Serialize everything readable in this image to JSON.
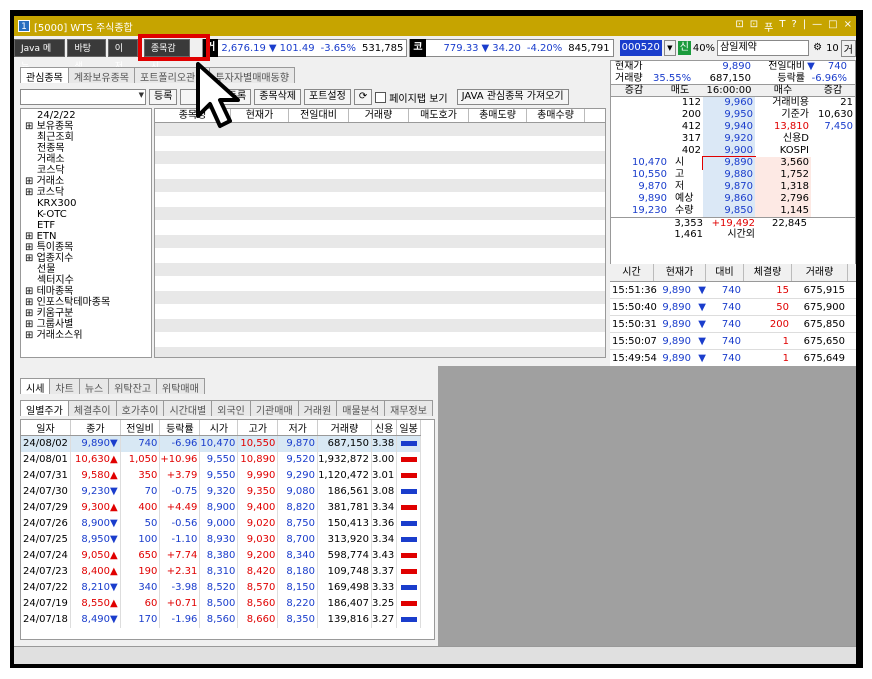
{
  "window": {
    "icon": "1",
    "title": "[5000] WTS 주식종합",
    "controls": [
      "⊡",
      "⊡",
      "푸",
      "T",
      "?",
      "|",
      "—",
      "□",
      "×"
    ]
  },
  "toolbar": {
    "java_menu": "Java 메뉴",
    "bg_color": "바탕색",
    "partial": "이저",
    "watch": "종목감시",
    "k_label": "거",
    "kospi": "2,676.19",
    "kospi_arrow": "▼",
    "kospi_change": "101.49",
    "kospi_pct": "-3.65%",
    "kospi_vol": "531,785",
    "q_label": "코",
    "kosdaq": "779.33",
    "kosdaq_arrow": "▼",
    "kosdaq_change": "34.20",
    "kosdaq_pct": "-4.20%",
    "kosdaq_vol": "845,791"
  },
  "stock_header": {
    "code": "000520",
    "badge": "신",
    "margin": "40%",
    "name": "삼일제약",
    "qty": "10",
    "geo": "거"
  },
  "tabs_top": [
    "관심종목",
    "계좌보유종목",
    "포트폴리오관리",
    "투자자별매매동향"
  ],
  "toolbar2": {
    "reg": "등록",
    "partial_reg": "종목등록",
    "del": "종목삭제",
    "pf_set": "포트설정",
    "page_view": "페이지탭 보기",
    "java_import": "JAVA 관심종목 가져오기"
  },
  "tree": [
    "24/2/22",
    "보유종목",
    "최근조회",
    "전종목",
    "거래소",
    "코스닥",
    "거래소",
    "코스닥",
    "KRX300",
    "K-OTC",
    "ETF",
    "ETN",
    "특이종목",
    "업종지수",
    "선물",
    "섹터지수",
    "테마종목",
    "인포스탁테마종목",
    "키움구분",
    "그룹사별",
    "거래소스위"
  ],
  "grid1_headers": [
    "종목명",
    "현재가",
    "전일대비",
    "거래량",
    "매도호가",
    "총매도량",
    "총매수량"
  ],
  "quote": {
    "cur_label": "현재가",
    "cur": "9,890",
    "prev_label": "전일대비",
    "prev_arrow": "▼",
    "prev": "740",
    "vol_label": "거래량",
    "vol_pct": "35.55%",
    "vol": "687,150",
    "rate_label": "등락률",
    "rate": "-6.96%",
    "h_change": "증감",
    "h_sell": "매도",
    "h_time": "16:00:00",
    "h_buy": "매수",
    "h_change2": "증감",
    "asks": [
      {
        "qty": "112",
        "price": "9,960",
        "info_label": "거래비용",
        "info": "21"
      },
      {
        "qty": "200",
        "price": "9,950",
        "info_label": "기준가",
        "info": "10,630"
      },
      {
        "qty": "412",
        "price": "9,940",
        "info_label": "13,810",
        "info": "7,450"
      },
      {
        "qty": "317",
        "price": "9,920",
        "info_label": "신용D",
        "info": ""
      },
      {
        "qty": "402",
        "price": "9,900",
        "info_label": "KOSPI",
        "info": ""
      }
    ],
    "bids": [
      {
        "left": "10,470",
        "tag": "시",
        "price": "9,890",
        "qty": "3,560"
      },
      {
        "left": "10,550",
        "tag": "고",
        "price": "9,880",
        "qty": "1,752"
      },
      {
        "left": "9,870",
        "tag": "저",
        "price": "9,870",
        "qty": "1,318"
      },
      {
        "left": "9,890",
        "tag": "예상",
        "price": "9,860",
        "qty": "2,796"
      },
      {
        "left": "19,230",
        "tag": "수량",
        "price": "9,850",
        "qty": "1,145"
      }
    ],
    "total_ask": "3,353",
    "total_diff": "+19,492",
    "total_bid": "22,845",
    "after_ask": "1,461",
    "after_label": "시간외"
  },
  "tick_headers": [
    "시간",
    "현재가",
    "대비",
    "체결량",
    "거래량"
  ],
  "ticks": [
    {
      "time": "15:51:36",
      "price": "9,890",
      "arrow": "▼",
      "diff": "740",
      "vol": "15",
      "total": "675,915"
    },
    {
      "time": "15:50:40",
      "price": "9,890",
      "arrow": "▼",
      "diff": "740",
      "vol": "50",
      "total": "675,900"
    },
    {
      "time": "15:50:31",
      "price": "9,890",
      "arrow": "▼",
      "diff": "740",
      "vol": "200",
      "total": "675,850"
    },
    {
      "time": "15:50:07",
      "price": "9,890",
      "arrow": "▼",
      "diff": "740",
      "vol": "1",
      "total": "675,650"
    },
    {
      "time": "15:49:54",
      "price": "9,890",
      "arrow": "▼",
      "diff": "740",
      "vol": "1",
      "total": "675,649"
    }
  ],
  "lower_tabs": [
    "시세",
    "차트",
    "뉴스",
    "위탁잔고",
    "위탁매매"
  ],
  "lower_subtabs": [
    "일별주가",
    "체결추이",
    "호가추이",
    "시간대별",
    "외국인",
    "기관매매",
    "거래원",
    "매물분석",
    "재무정보"
  ],
  "daily_headers": [
    "일자",
    "종가",
    "전일비",
    "등락률",
    "시가",
    "고가",
    "저가",
    "거래량",
    "신용",
    "일봉"
  ],
  "daily": [
    {
      "d": "24/08/02",
      "c": "9,890",
      "a": "▼",
      "ch": "740",
      "p": "-6.96",
      "o": "10,470",
      "h": "10,550",
      "l": "9,870",
      "v": "687,150",
      "cr": "3.38",
      "up": false
    },
    {
      "d": "24/08/01",
      "c": "10,630",
      "a": "▲",
      "ch": "1,050",
      "p": "+10.96",
      "o": "9,550",
      "h": "10,890",
      "l": "9,520",
      "v": "1,932,872",
      "cr": "3.00",
      "up": true
    },
    {
      "d": "24/07/31",
      "c": "9,580",
      "a": "▲",
      "ch": "350",
      "p": "+3.79",
      "o": "9,550",
      "h": "9,990",
      "l": "9,290",
      "v": "1,120,472",
      "cr": "3.01",
      "up": true
    },
    {
      "d": "24/07/30",
      "c": "9,230",
      "a": "▼",
      "ch": "70",
      "p": "-0.75",
      "o": "9,320",
      "h": "9,350",
      "l": "9,080",
      "v": "186,561",
      "cr": "3.08",
      "up": false
    },
    {
      "d": "24/07/29",
      "c": "9,300",
      "a": "▲",
      "ch": "400",
      "p": "+4.49",
      "o": "8,900",
      "h": "9,400",
      "l": "8,820",
      "v": "381,781",
      "cr": "3.34",
      "up": true
    },
    {
      "d": "24/07/26",
      "c": "8,900",
      "a": "▼",
      "ch": "50",
      "p": "-0.56",
      "o": "9,000",
      "h": "9,020",
      "l": "8,750",
      "v": "150,413",
      "cr": "3.36",
      "up": false
    },
    {
      "d": "24/07/25",
      "c": "8,950",
      "a": "▼",
      "ch": "100",
      "p": "-1.10",
      "o": "8,930",
      "h": "9,030",
      "l": "8,700",
      "v": "313,920",
      "cr": "3.34",
      "up": false
    },
    {
      "d": "24/07/24",
      "c": "9,050",
      "a": "▲",
      "ch": "650",
      "p": "+7.74",
      "o": "8,380",
      "h": "9,200",
      "l": "8,340",
      "v": "598,774",
      "cr": "3.43",
      "up": true
    },
    {
      "d": "24/07/23",
      "c": "8,400",
      "a": "▲",
      "ch": "190",
      "p": "+2.31",
      "o": "8,310",
      "h": "8,420",
      "l": "8,180",
      "v": "109,748",
      "cr": "3.37",
      "up": true
    },
    {
      "d": "24/07/22",
      "c": "8,210",
      "a": "▼",
      "ch": "340",
      "p": "-3.98",
      "o": "8,520",
      "h": "8,570",
      "l": "8,150",
      "v": "169,498",
      "cr": "3.33",
      "up": false
    },
    {
      "d": "24/07/19",
      "c": "8,550",
      "a": "▲",
      "ch": "60",
      "p": "+0.71",
      "o": "8,500",
      "h": "8,560",
      "l": "8,220",
      "v": "186,407",
      "cr": "3.25",
      "up": true
    },
    {
      "d": "24/07/18",
      "c": "8,490",
      "a": "▼",
      "ch": "170",
      "p": "-1.96",
      "o": "8,560",
      "h": "8,660",
      "l": "8,350",
      "v": "139,816",
      "cr": "3.27",
      "up": false
    }
  ]
}
